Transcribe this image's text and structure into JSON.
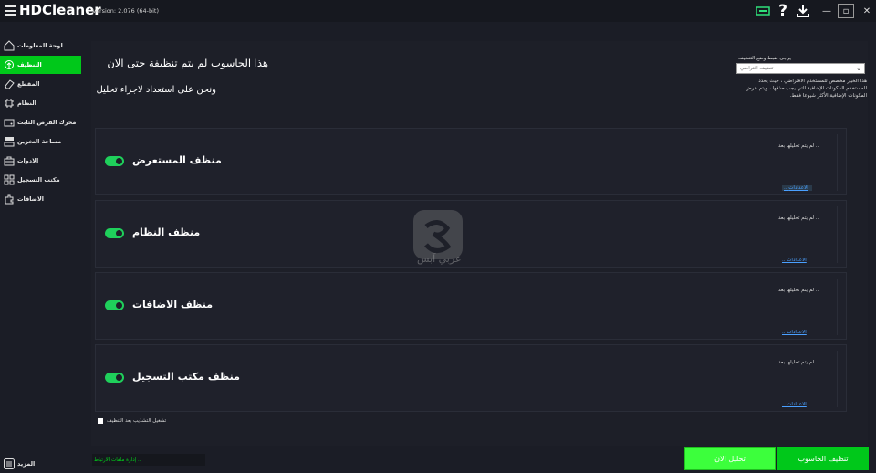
{
  "app": {
    "name": "HDCleaner",
    "version": "Version: 2.076 (64-bit)"
  },
  "titlebar": {
    "minimize": "—",
    "restore": "▫",
    "close": "✕"
  },
  "sidebar": {
    "items": [
      {
        "label": "لوحة المعلومات",
        "icon": "home-icon"
      },
      {
        "label": "التنظيف",
        "icon": "recycle-icon",
        "active": true
      },
      {
        "label": "المقطع",
        "icon": "eraser-icon"
      },
      {
        "label": "النظام",
        "icon": "chip-icon"
      },
      {
        "label": "محرك القرص الثابت",
        "icon": "drive-icon"
      },
      {
        "label": "مساحة التخزين",
        "icon": "storage-icon"
      },
      {
        "label": "الادوات",
        "icon": "toolbox-icon"
      },
      {
        "label": "مكتب التسجيل",
        "icon": "registry-icon"
      },
      {
        "label": "الاضافات",
        "icon": "plugin-icon"
      }
    ],
    "more": "المزيد"
  },
  "main": {
    "title": "هذا الحاسوب لم يتم تنظيفة حتى الان",
    "subtitle": "ونحن على استعداد لاجراء تحليل",
    "mode_label": "يرجى ضبط وضع التنظيف",
    "mode_value": "تنظيف افتراضي",
    "mode_description": "هذا الخيار مخصص للمستخدم الافتراضي ، حيث يحدد المستخدم المكونات الإضافية التي يجب حذفها ، ويتم عرض المكونات الإضافية الأكثر شيوعا فقط."
  },
  "cards": [
    {
      "title": "منظف المستعرض",
      "status": "لم يتم تحليلها بعد ..",
      "link": ".. الاعدادات",
      "enabled": true
    },
    {
      "title": "منظف النظام",
      "status": "لم يتم تحليلها بعد ..",
      "link": ".. الاعدادات",
      "enabled": true
    },
    {
      "title": "منظف الاضافات",
      "status": "لم يتم تحليلها بعد ..",
      "link": ".. الاعدادات",
      "enabled": true
    },
    {
      "title": "منظف مكتب التسجيل",
      "status": "لم يتم تحليلها بعد ..",
      "link": ".. الاعدادات",
      "enabled": true
    }
  ],
  "shutdown_label": "تشغيل التشذيب بعد التنظيف",
  "status_bar": "إدارة ملفات الارتباط ..",
  "buttons": {
    "analyze": "تحليل الان",
    "clean": "تنظيف الحاسوب"
  },
  "watermark": "عربي آبس",
  "colors": {
    "accent": "#00c81a",
    "analyze": "#3cff3c",
    "toggle": "#1fd05b",
    "link": "#4aa0ff",
    "background": "#1b1d26"
  }
}
